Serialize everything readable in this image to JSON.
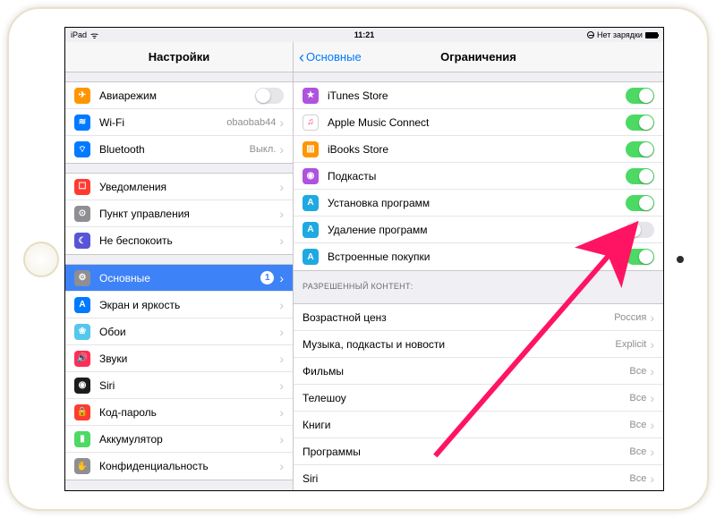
{
  "status": {
    "carrier": "iPad",
    "time": "11:21",
    "battery_text": "Нет зарядки"
  },
  "sidebar": {
    "title": "Настройки",
    "groups": [
      {
        "items": [
          {
            "id": "airplane",
            "label": "Авиарежим",
            "icon_bg": "#ff9500",
            "icon_glyph": "✈",
            "control": "toggle",
            "toggle_on": false
          },
          {
            "id": "wifi",
            "label": "Wi-Fi",
            "icon_bg": "#007aff",
            "icon_glyph": "≋",
            "value": "obaobab44",
            "chevron": true
          },
          {
            "id": "bluetooth",
            "label": "Bluetooth",
            "icon_bg": "#007aff",
            "icon_glyph": "⌔",
            "value": "Выкл.",
            "chevron": true
          }
        ]
      },
      {
        "items": [
          {
            "id": "notifications",
            "label": "Уведомления",
            "icon_bg": "#ff3b30",
            "icon_glyph": "☐",
            "chevron": true
          },
          {
            "id": "control-center",
            "label": "Пункт управления",
            "icon_bg": "#8e8e93",
            "icon_glyph": "⊙",
            "chevron": true
          },
          {
            "id": "dnd",
            "label": "Не беспокоить",
            "icon_bg": "#5856d6",
            "icon_glyph": "☾",
            "chevron": true
          }
        ]
      },
      {
        "items": [
          {
            "id": "general",
            "label": "Основные",
            "icon_bg": "#8e8e93",
            "icon_glyph": "⚙",
            "badge": "1",
            "chevron": true,
            "selected": true
          },
          {
            "id": "display",
            "label": "Экран и яркость",
            "icon_bg": "#007aff",
            "icon_glyph": "A",
            "chevron": true
          },
          {
            "id": "wallpaper",
            "label": "Обои",
            "icon_bg": "#54c7ec",
            "icon_glyph": "❀",
            "chevron": true
          },
          {
            "id": "sounds",
            "label": "Звуки",
            "icon_bg": "#ff2d55",
            "icon_glyph": "🔊",
            "chevron": true
          },
          {
            "id": "siri",
            "label": "Siri",
            "icon_bg": "#1c1c1e",
            "icon_glyph": "◉",
            "chevron": true
          },
          {
            "id": "passcode",
            "label": "Код-пароль",
            "icon_bg": "#ff3b30",
            "icon_glyph": "🔒",
            "chevron": true
          },
          {
            "id": "battery",
            "label": "Аккумулятор",
            "icon_bg": "#4cd964",
            "icon_glyph": "▮",
            "chevron": true
          },
          {
            "id": "privacy",
            "label": "Конфиденциальность",
            "icon_bg": "#8e8e93",
            "icon_glyph": "✋",
            "chevron": true
          }
        ]
      }
    ]
  },
  "detail": {
    "back_label": "Основные",
    "title": "Ограничения",
    "groups": [
      {
        "header": null,
        "items": [
          {
            "id": "itunes-store",
            "label": "iTunes Store",
            "icon_bg": "#af52de",
            "icon_glyph": "★",
            "control": "toggle",
            "toggle_on": true
          },
          {
            "id": "apple-music",
            "label": "Apple Music Connect",
            "icon_bg": "#ffffff",
            "icon_border": true,
            "icon_glyph": "♫",
            "icon_color": "#ff2d55",
            "control": "toggle",
            "toggle_on": true
          },
          {
            "id": "ibooks",
            "label": "iBooks Store",
            "icon_bg": "#ff9500",
            "icon_glyph": "▥",
            "control": "toggle",
            "toggle_on": true
          },
          {
            "id": "podcasts",
            "label": "Подкасты",
            "icon_bg": "#af52de",
            "icon_glyph": "◉",
            "control": "toggle",
            "toggle_on": true
          },
          {
            "id": "install-apps",
            "label": "Установка программ",
            "icon_bg": "#1fa9e1",
            "icon_glyph": "A",
            "control": "toggle",
            "toggle_on": true
          },
          {
            "id": "delete-apps",
            "label": "Удаление программ",
            "icon_bg": "#1fa9e1",
            "icon_glyph": "A",
            "control": "toggle",
            "toggle_on": false,
            "highlight_target": true
          },
          {
            "id": "in-app",
            "label": "Встроенные покупки",
            "icon_bg": "#1fa9e1",
            "icon_glyph": "A",
            "control": "toggle",
            "toggle_on": true
          }
        ]
      },
      {
        "header": "РАЗРЕШЕННЫЙ КОНТЕНТ:",
        "items": [
          {
            "id": "ratings-for",
            "label": "Возрастной ценз",
            "value": "Россия",
            "chevron": true
          },
          {
            "id": "music",
            "label": "Музыка, подкасты и новости",
            "value": "Explicit",
            "chevron": true
          },
          {
            "id": "movies",
            "label": "Фильмы",
            "value": "Все",
            "chevron": true
          },
          {
            "id": "tv",
            "label": "Телешоу",
            "value": "Все",
            "chevron": true
          },
          {
            "id": "books",
            "label": "Книги",
            "value": "Все",
            "chevron": true
          },
          {
            "id": "apps",
            "label": "Программы",
            "value": "Все",
            "chevron": true
          },
          {
            "id": "siri-content",
            "label": "Siri",
            "value": "Все",
            "chevron": true
          }
        ]
      }
    ]
  },
  "arrow": {
    "color": "#ff1464"
  }
}
